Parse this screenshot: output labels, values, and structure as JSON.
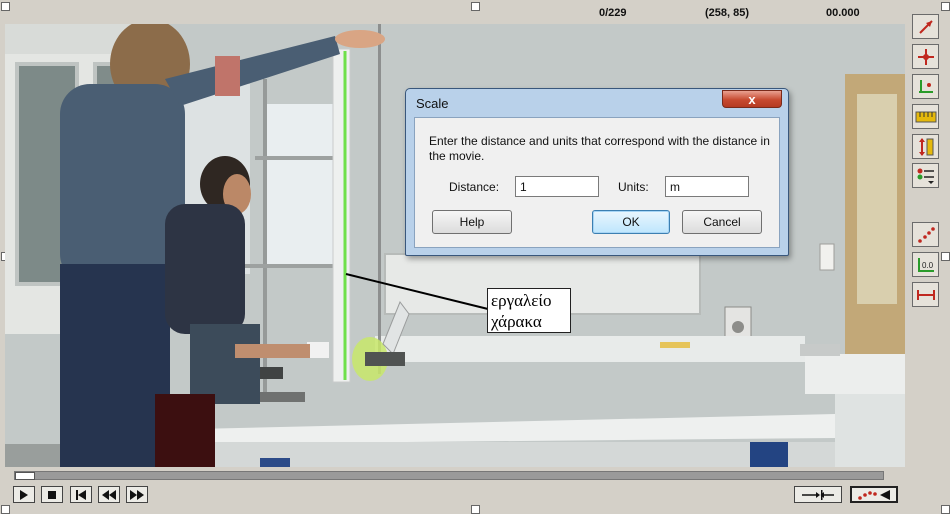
{
  "status": {
    "frame_counter": "0/229",
    "coordinates": "(258, 85)",
    "time": "00.000"
  },
  "callout": {
    "line1": "εργαλείο",
    "line2": "χάρακα"
  },
  "dialog": {
    "title": "Scale",
    "close_glyph": "x",
    "prompt": "Enter the distance and units that correspond with the distance in the movie.",
    "distance_label": "Distance:",
    "distance_value": "1",
    "units_label": "Units:",
    "units_value": "m",
    "help_label": "Help",
    "ok_label": "OK",
    "cancel_label": "Cancel"
  },
  "tools": [
    {
      "name": "select-arrow-icon"
    },
    {
      "name": "origin-point-icon"
    },
    {
      "name": "axes-icon"
    },
    {
      "name": "ruler-scale-icon"
    },
    {
      "name": "vertical-scale-icon"
    },
    {
      "name": "data-list-icon"
    },
    {
      "name": "trail-points-icon"
    },
    {
      "name": "zero-marker-icon"
    },
    {
      "name": "measure-distance-icon"
    }
  ],
  "colors": {
    "accent_red": "#d0191b",
    "ruler_green": "#6fe04a",
    "dialog_frame": "#b9d1ea"
  }
}
